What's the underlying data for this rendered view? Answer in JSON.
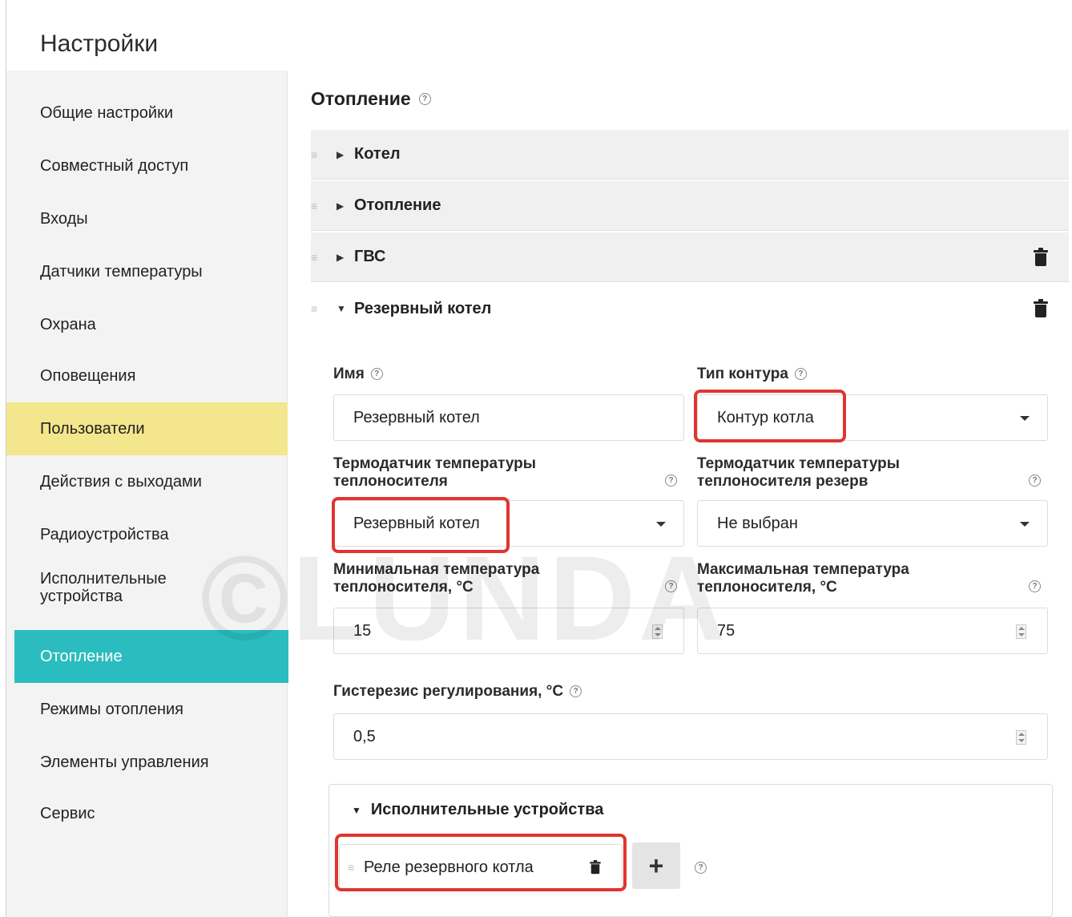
{
  "window": {
    "title": "Настройки"
  },
  "sidebar": {
    "items": [
      {
        "label": "Общие настройки"
      },
      {
        "label": "Совместный доступ"
      },
      {
        "label": "Входы"
      },
      {
        "label": "Датчики температуры"
      },
      {
        "label": "Охрана"
      },
      {
        "label": "Оповещения"
      },
      {
        "label": "Пользователи"
      },
      {
        "label": "Действия с выходами"
      },
      {
        "label": "Радиоустройства"
      },
      {
        "label": "Исполнительные устройства"
      },
      {
        "label": "Отопление"
      },
      {
        "label": "Режимы отопления"
      },
      {
        "label": "Элементы управления"
      },
      {
        "label": "Сервис"
      }
    ],
    "active_item": "Отопление",
    "highlighted_item": "Пользователи"
  },
  "content": {
    "title": "Отопление",
    "help_icon": "question-circle-icon",
    "panels": [
      {
        "label": "Котел",
        "expanded": false
      },
      {
        "label": "Отопление",
        "expanded": false
      },
      {
        "label": "ГВС",
        "expanded": false
      },
      {
        "label": "Резервный котел",
        "expanded": true
      }
    ],
    "form": {
      "name_label": "Имя",
      "name_value": "Резервный котел",
      "contour_type_label": "Тип контура",
      "contour_type_value": "Контур котла",
      "sensor_label": "Термодатчик температуры теплоносителя",
      "sensor_value": "Резервный котел",
      "sensor_reserve_label": "Термодатчик температуры теплоносителя резерв",
      "sensor_reserve_value": "Не выбран",
      "min_temp_label": "Минимальная температура теплоносителя, °С",
      "min_temp_value": "15",
      "max_temp_label": "Максимальная температура теплоносителя, °С",
      "max_temp_value": "75",
      "hysteresis_label": "Гистерезис регулирования, °С",
      "hysteresis_value": "0,5"
    },
    "devices": {
      "title": "Исполнительные устройства",
      "items": [
        {
          "label": "Реле резервного котла"
        }
      ],
      "add_label": "+"
    }
  },
  "watermark": "©LUNDA",
  "colors": {
    "active": "#2bbcbf",
    "highlight": "#f4e68c",
    "annotation": "#e03530"
  }
}
